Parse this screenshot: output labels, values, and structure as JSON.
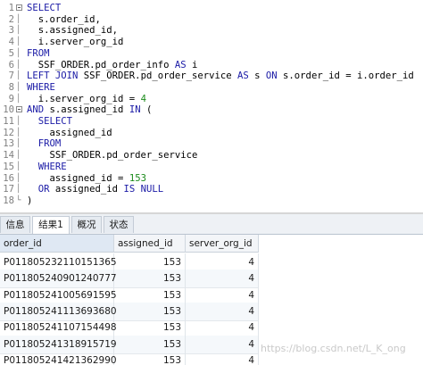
{
  "editor": {
    "lines": [
      {
        "n": "1",
        "parts": [
          {
            "t": "SELECT",
            "c": "kw"
          }
        ]
      },
      {
        "n": "2",
        "parts": [
          {
            "t": "  s.order_id,",
            "c": ""
          }
        ]
      },
      {
        "n": "3",
        "parts": [
          {
            "t": "  s.assigned_id,",
            "c": ""
          }
        ]
      },
      {
        "n": "4",
        "parts": [
          {
            "t": "  i.server_org_id",
            "c": ""
          }
        ]
      },
      {
        "n": "5",
        "parts": [
          {
            "t": "FROM",
            "c": "kw"
          }
        ]
      },
      {
        "n": "6",
        "parts": [
          {
            "t": "  SSF_ORDER.pd_order_info ",
            "c": ""
          },
          {
            "t": "AS",
            "c": "kw"
          },
          {
            "t": " i",
            "c": ""
          }
        ]
      },
      {
        "n": "7",
        "parts": [
          {
            "t": "LEFT JOIN",
            "c": "kw"
          },
          {
            "t": " SSF_ORDER.pd_order_service ",
            "c": ""
          },
          {
            "t": "AS",
            "c": "kw"
          },
          {
            "t": " s ",
            "c": ""
          },
          {
            "t": "ON",
            "c": "kw"
          },
          {
            "t": " s.order_id = i.order_id",
            "c": ""
          }
        ]
      },
      {
        "n": "8",
        "parts": [
          {
            "t": "WHERE",
            "c": "kw"
          }
        ]
      },
      {
        "n": "9",
        "parts": [
          {
            "t": "  i.server_org_id = ",
            "c": ""
          },
          {
            "t": "4",
            "c": "num"
          }
        ]
      },
      {
        "n": "10",
        "parts": [
          {
            "t": "AND",
            "c": "kw"
          },
          {
            "t": " s.assigned_id ",
            "c": ""
          },
          {
            "t": "IN",
            "c": "kw"
          },
          {
            "t": " (",
            "c": ""
          }
        ]
      },
      {
        "n": "11",
        "parts": [
          {
            "t": "  SELECT",
            "c": "kw"
          }
        ]
      },
      {
        "n": "12",
        "parts": [
          {
            "t": "    assigned_id",
            "c": ""
          }
        ]
      },
      {
        "n": "13",
        "parts": [
          {
            "t": "  FROM",
            "c": "kw"
          }
        ]
      },
      {
        "n": "14",
        "parts": [
          {
            "t": "    SSF_ORDER.pd_order_service",
            "c": ""
          }
        ]
      },
      {
        "n": "15",
        "parts": [
          {
            "t": "  WHERE",
            "c": "kw"
          }
        ]
      },
      {
        "n": "16",
        "parts": [
          {
            "t": "    assigned_id = ",
            "c": ""
          },
          {
            "t": "153",
            "c": "num"
          }
        ]
      },
      {
        "n": "17",
        "parts": [
          {
            "t": "  OR",
            "c": "kw"
          },
          {
            "t": " assigned_id ",
            "c": ""
          },
          {
            "t": "IS NULL",
            "c": "kw"
          }
        ]
      },
      {
        "n": "18",
        "parts": [
          {
            "t": ")",
            "c": ""
          }
        ]
      }
    ]
  },
  "tabs": [
    "信息",
    "结果1",
    "概况",
    "状态"
  ],
  "active_tab": "结果1",
  "grid": {
    "columns": [
      "order_id",
      "assigned_id",
      "server_org_id"
    ],
    "rows": [
      [
        "P011805232110151365",
        "153",
        "4"
      ],
      [
        "P011805240901240777",
        "153",
        "4"
      ],
      [
        "P011805241005691595",
        "153",
        "4"
      ],
      [
        "P011805241113693680",
        "153",
        "4"
      ],
      [
        "P011805241107154498",
        "153",
        "4"
      ],
      [
        "P011805241318915719",
        "153",
        "4"
      ],
      [
        "P011805241421362990",
        "153",
        "4"
      ]
    ]
  },
  "watermark": "https://blog.csdn.net/L_K_ong"
}
